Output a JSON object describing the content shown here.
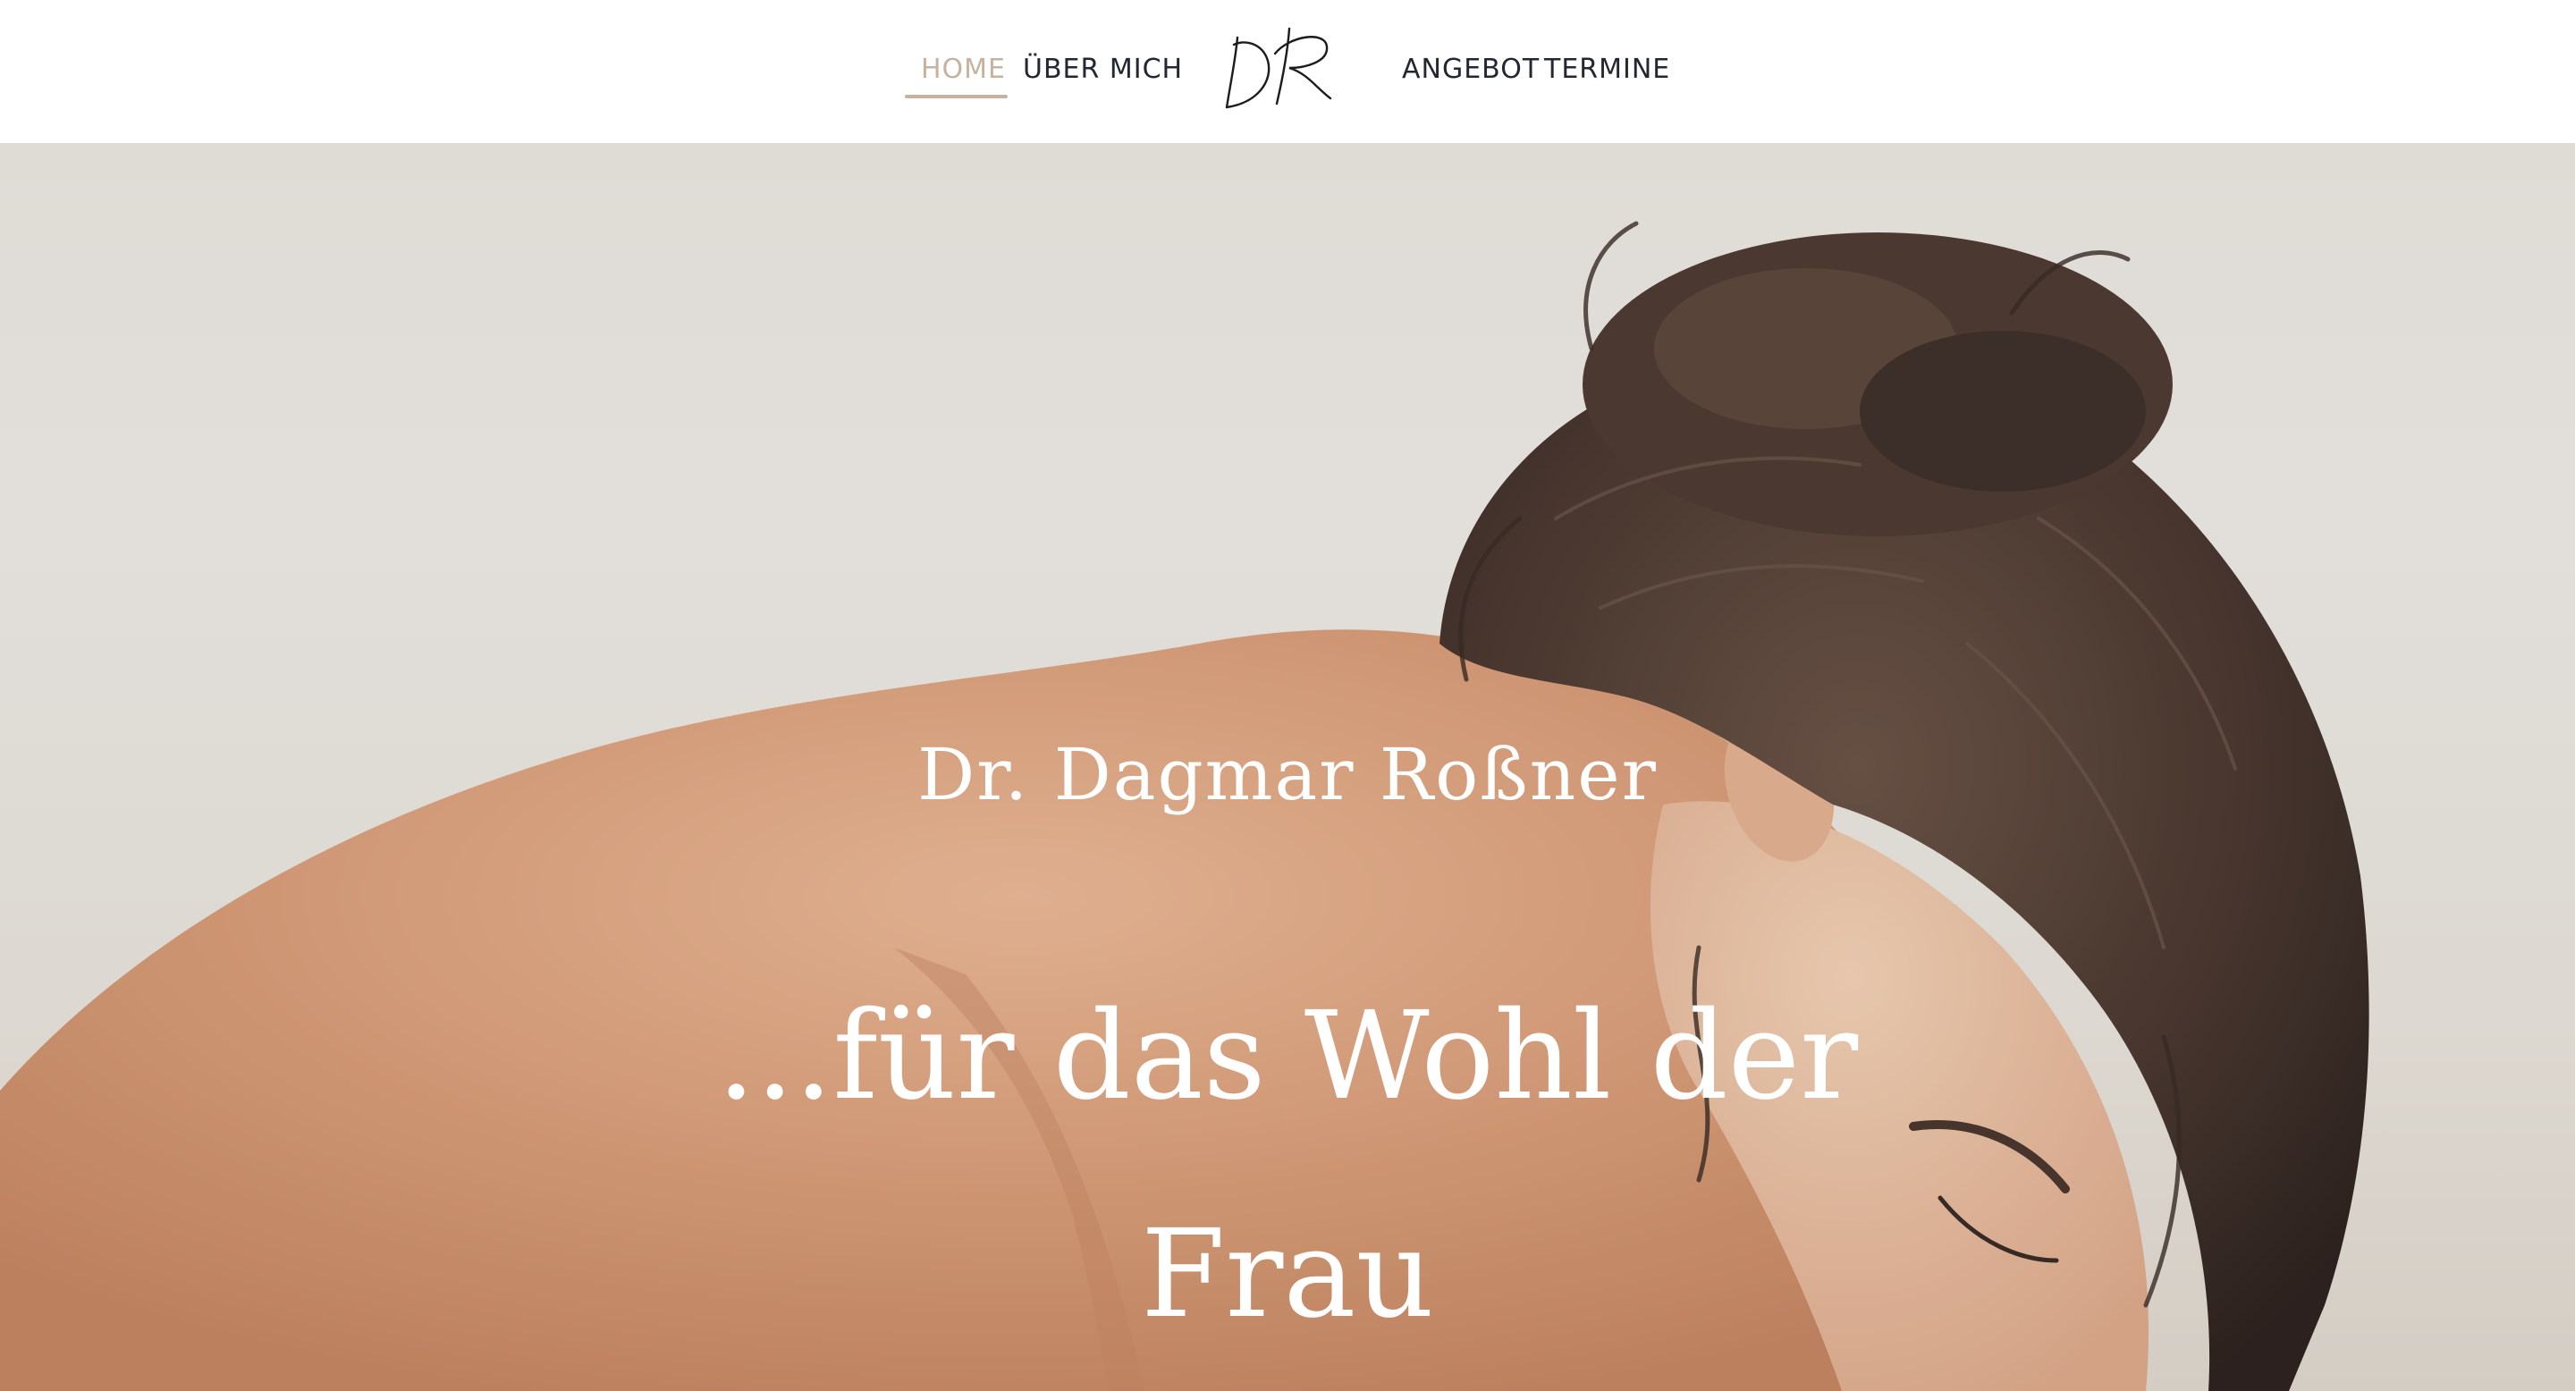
{
  "nav": {
    "home": "HOME",
    "about": "ÜBER MICH",
    "offer": "ANGEBOT",
    "appointments": "TERMINE",
    "logo_text": "DR"
  },
  "hero": {
    "name": "Dr. Dagmar Roßner",
    "tagline": "...für das Wohl der Frau",
    "image": "woman-bending-hair-bun-photo"
  },
  "colors": {
    "accent": "#c7b29f",
    "nav_text": "#222831",
    "hero_text": "#ffffff",
    "background": "#ece9e4"
  }
}
